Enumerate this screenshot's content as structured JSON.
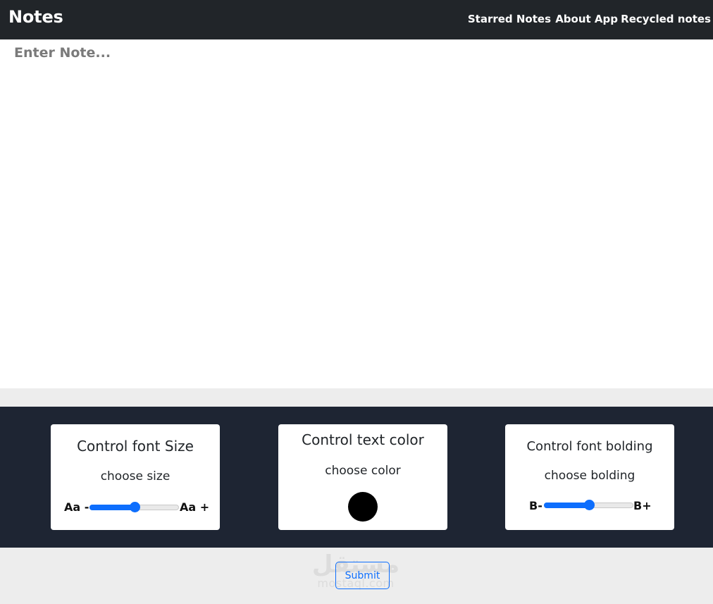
{
  "navbar": {
    "brand": "Notes",
    "links": [
      "Starred Notes",
      "About App",
      "Recycled notes"
    ]
  },
  "editor": {
    "placeholder": "Enter Note...",
    "value": ""
  },
  "controls": {
    "font_size": {
      "title": "Control font Size",
      "subtitle": "choose size",
      "min_label": "Aa -",
      "max_label": "Aa +",
      "value_fraction": 0.5
    },
    "text_color": {
      "title": "Control text color",
      "subtitle": "choose color",
      "value": "#000000"
    },
    "font_bolding": {
      "title": "Control font bolding",
      "subtitle": "choose bolding",
      "min_label": "B-",
      "max_label": "B+",
      "value_fraction": 0.5
    }
  },
  "actions": {
    "submit_label": "Submit"
  },
  "watermark": {
    "arabic": "مستقل",
    "latin": "mostaql.com"
  },
  "colors": {
    "navbar": "#212529",
    "controls_band": "#1e2533",
    "accent": "#0d6efd",
    "page_bg": "#ededed"
  }
}
